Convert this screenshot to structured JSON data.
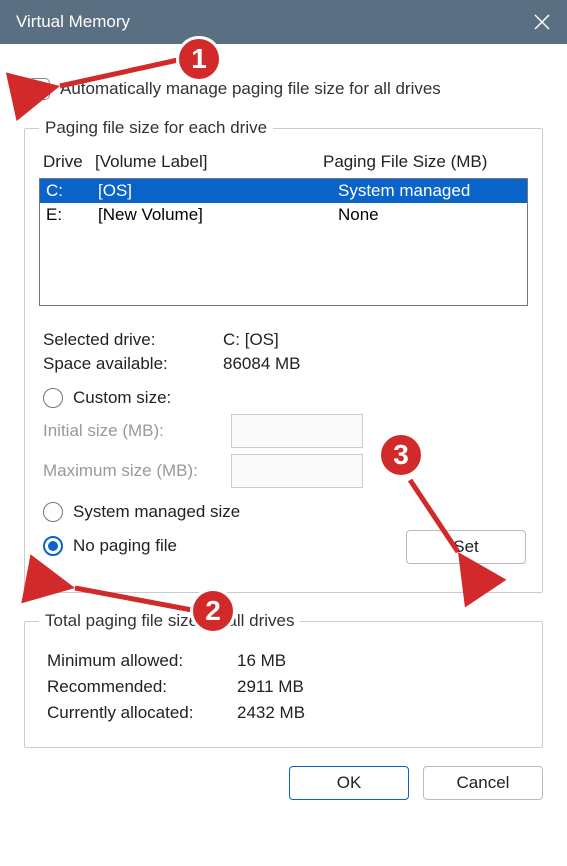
{
  "title": "Virtual Memory",
  "auto_manage_label": "Automatically manage paging file size for all drives",
  "group_drive_legend": "Paging file size for each drive",
  "headers": {
    "drive": "Drive",
    "volume": "[Volume Label]",
    "paging": "Paging File Size (MB)"
  },
  "drives": [
    {
      "letter": "C:",
      "label": "[OS]",
      "paging": "System managed"
    },
    {
      "letter": "E:",
      "label": "[New Volume]",
      "paging": "None"
    }
  ],
  "selected_drive_label": "Selected drive:",
  "selected_drive_value": "C:  [OS]",
  "space_label": "Space available:",
  "space_value": "86084 MB",
  "custom_size_label": "Custom size:",
  "initial_size_label": "Initial size (MB):",
  "max_size_label": "Maximum size (MB):",
  "system_managed_label": "System managed size",
  "no_paging_label": "No paging file",
  "set_label": "Set",
  "totals_legend": "Total paging file size for all drives",
  "min_allowed_label": "Minimum allowed:",
  "min_allowed_value": "16 MB",
  "recommended_label": "Recommended:",
  "recommended_value": "2911 MB",
  "currently_label": "Currently allocated:",
  "currently_value": "2432 MB",
  "ok_label": "OK",
  "cancel_label": "Cancel",
  "anno": {
    "one": "1",
    "two": "2",
    "three": "3"
  }
}
